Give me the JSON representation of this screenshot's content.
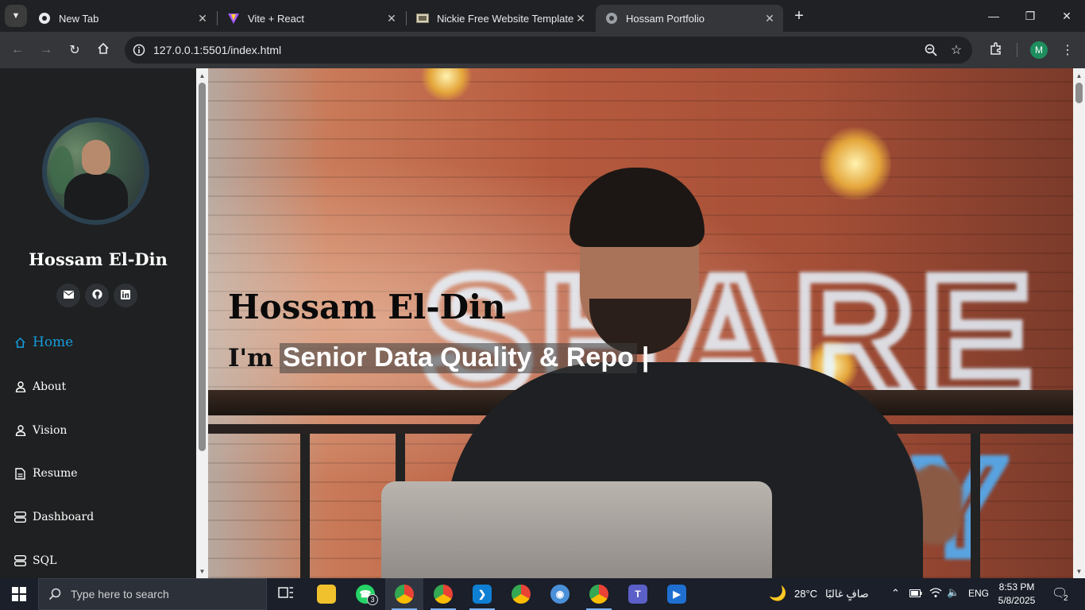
{
  "browser": {
    "tabs": [
      {
        "title": "New Tab"
      },
      {
        "title": "Vite + React"
      },
      {
        "title": "Nickie Free Website Template | F"
      },
      {
        "title": "Hossam Portfolio"
      }
    ],
    "url": "127.0.0.1:5501/index.html",
    "profile_initial": "M"
  },
  "sidebar": {
    "name": "Hossam El-Din",
    "social": [
      "mail-icon",
      "github-icon",
      "linkedin-icon"
    ],
    "nav": [
      {
        "label": "Home",
        "icon": "home-icon",
        "active": true
      },
      {
        "label": "About",
        "icon": "person-icon"
      },
      {
        "label": "Vision",
        "icon": "person-icon"
      },
      {
        "label": "Resume",
        "icon": "document-icon"
      },
      {
        "label": "Dashboard",
        "icon": "server-icon"
      },
      {
        "label": "SQL",
        "icon": "server-icon"
      }
    ]
  },
  "hero": {
    "title": "Hossam El-Din",
    "prefix": "I'm",
    "typed": "Senior Data Quality & Repo",
    "cursor": "|"
  },
  "taskbar": {
    "search_placeholder": "Type here to search",
    "whatsapp_badge": "3",
    "weather_temp": "28°C",
    "weather_text": "صافٍ غالبًا",
    "language": "ENG",
    "time": "8:53 PM",
    "date": "5/8/2025",
    "notification_count": "2"
  },
  "colors": {
    "accent": "#149ddd",
    "sidebar_bg": "#1f2021",
    "chrome_bg": "#202124",
    "toolbar_bg": "#35363a"
  }
}
